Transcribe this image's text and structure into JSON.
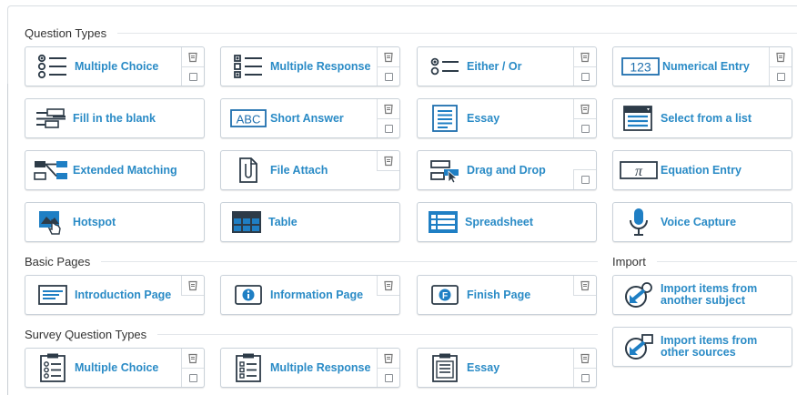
{
  "sections": {
    "question_types": "Question Types",
    "basic_pages": "Basic Pages",
    "import": "Import",
    "survey_question_types": "Survey Question Types"
  },
  "question_types": [
    {
      "label": "Multiple Choice",
      "icon": "multiple-choice-icon"
    },
    {
      "label": "Multiple Response",
      "icon": "multiple-response-icon"
    },
    {
      "label": "Either / Or",
      "icon": "either-or-icon"
    },
    {
      "label": "Numerical Entry",
      "icon": "numerical-entry-icon",
      "icon_text": "123"
    },
    {
      "label": "Fill in the blank",
      "icon": "fill-in-the-blank-icon"
    },
    {
      "label": "Short Answer",
      "icon": "short-answer-icon",
      "icon_text": "ABC"
    },
    {
      "label": "Essay",
      "icon": "essay-icon"
    },
    {
      "label": "Select from a list",
      "icon": "select-from-list-icon"
    },
    {
      "label": "Extended Matching",
      "icon": "extended-matching-icon"
    },
    {
      "label": "File Attach",
      "icon": "file-attach-icon"
    },
    {
      "label": "Drag and Drop",
      "icon": "drag-and-drop-icon"
    },
    {
      "label": "Equation Entry",
      "icon": "equation-entry-icon",
      "icon_text": "π"
    },
    {
      "label": "Hotspot",
      "icon": "hotspot-icon"
    },
    {
      "label": "Table",
      "icon": "table-icon"
    },
    {
      "label": "Spreadsheet",
      "icon": "spreadsheet-icon"
    },
    {
      "label": "Voice Capture",
      "icon": "voice-capture-icon"
    }
  ],
  "basic_pages": [
    {
      "label": "Introduction Page",
      "icon": "introduction-page-icon"
    },
    {
      "label": "Information Page",
      "icon": "information-page-icon"
    },
    {
      "label": "Finish Page",
      "icon": "finish-page-icon",
      "icon_text": "F"
    }
  ],
  "import_items": [
    {
      "label_line1": "Import items from",
      "label_line2": "another subject",
      "icon": "import-subject-icon"
    },
    {
      "label_line1": "Import items from",
      "label_line2": "other sources",
      "icon": "import-sources-icon"
    }
  ],
  "survey_types": [
    {
      "label": "Multiple Choice",
      "icon": "survey-multiple-choice-icon"
    },
    {
      "label": "Multiple Response",
      "icon": "survey-multiple-response-icon"
    },
    {
      "label": "Essay",
      "icon": "survey-essay-icon"
    }
  ],
  "colors": {
    "label": "#2a8bc6",
    "icon_blue": "#1f7fc4",
    "icon_dark": "#2d3b48"
  }
}
